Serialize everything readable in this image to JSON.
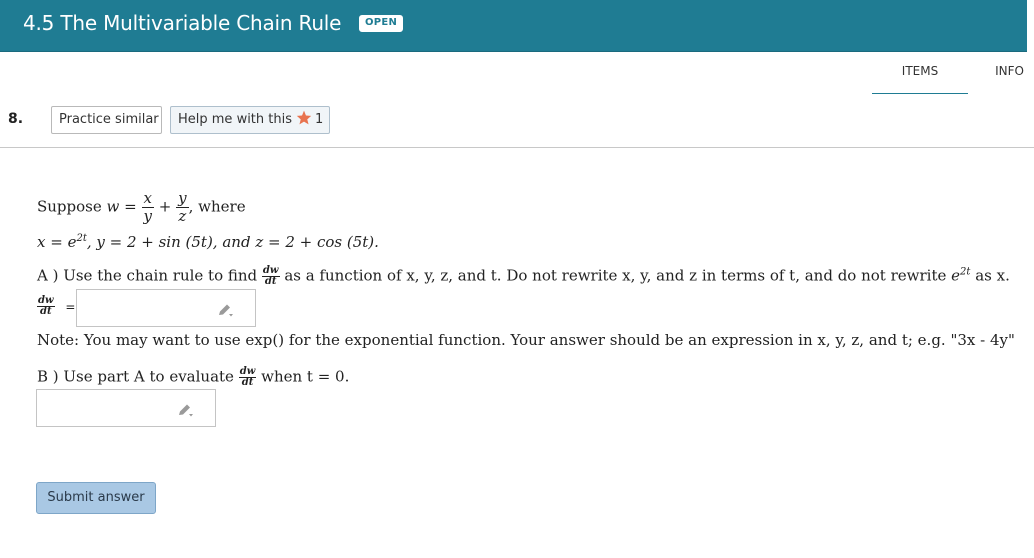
{
  "header": {
    "title": "4.5 The Multivariable Chain Rule",
    "badge": "OPEN"
  },
  "tabs": {
    "items": "ITEMS",
    "info": "INFO"
  },
  "question": {
    "number": "8.",
    "practice_label": "Practice similar",
    "help_label": "Help me with this",
    "help_count": "1"
  },
  "problem": {
    "suppose_word": "Suppose",
    "w_lhs": "w =",
    "frac1_num": "x",
    "frac1_den": "y",
    "plus": "+",
    "frac2_num": "y",
    "frac2_den": "z",
    "where_word": ", where",
    "line2_x": "x = e",
    "line2_x_exp": "2t",
    "line2_y": ",  y = 2 + sin (5t), and z = 2 + cos (5t)."
  },
  "part_a": {
    "label": "A ) Use the chain rule to find",
    "frac_num": "dw",
    "frac_den": "dt",
    "rest": "as a function of x, y, z, and t. Do not rewrite x, y, and z in terms of t, and do not rewrite",
    "e_base": "e",
    "e_exp": "2t",
    "tail": "as x.",
    "answer_label_num": "dw",
    "answer_label_den": "dt",
    "equals": "=",
    "answer_value": ""
  },
  "note": {
    "text": "Note: You may want to use exp() for the exponential function. Your answer should be an expression in x, y, z, and t; e.g. \"3x - 4y\""
  },
  "part_b": {
    "label": "B ) Use part A to evaluate",
    "frac_num": "dw",
    "frac_den": "dt",
    "when": "when t = 0.",
    "answer_value": ""
  },
  "submit_label": "Submit answer",
  "colors": {
    "header_bg": "#1f7c93",
    "star": "#e8734f",
    "submit_bg": "#a9c8e4"
  }
}
